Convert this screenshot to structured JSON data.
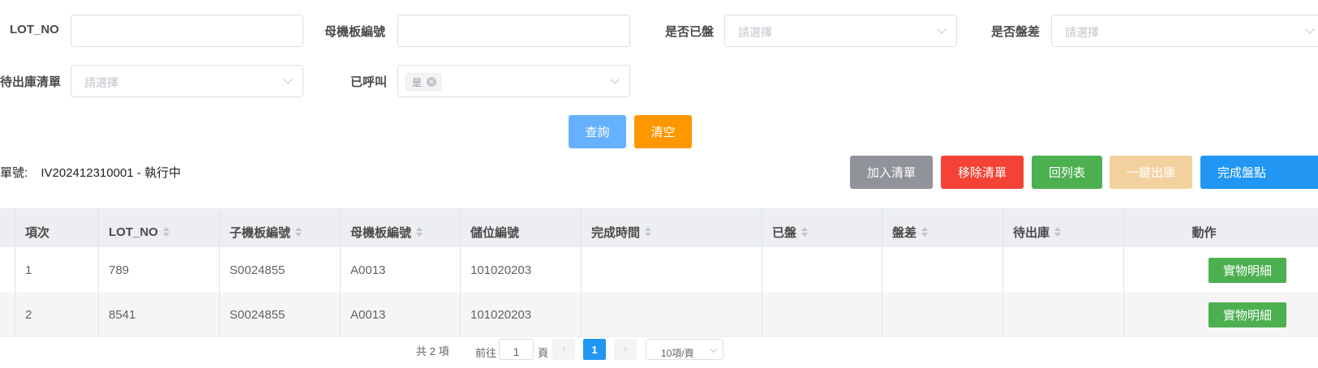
{
  "filters": {
    "lot_no_label": "LOT_NO",
    "mother_board_label": "母機板編號",
    "counted_label": "是否已盤",
    "diff_label": "是否盤差",
    "pending_out_label": "待出庫清單",
    "called_label": "已呼叫",
    "placeholder": "請選擇",
    "called_tag": "是"
  },
  "buttons": {
    "query": "查詢",
    "clear": "清空",
    "add_list": "加入清單",
    "remove_list": "移除清單",
    "back_list": "回列表",
    "one_click_out": "一鍵出庫",
    "finish_count": "完成盤點"
  },
  "order": {
    "label": "盤單號:",
    "value": "IV202412310001 - 執行中"
  },
  "table": {
    "columns": [
      "項次",
      "LOT_NO",
      "子機板編號",
      "母機板編號",
      "儲位編號",
      "完成時間",
      "已盤",
      "盤差",
      "待出庫",
      "動作"
    ],
    "rows": [
      {
        "idx": "1",
        "lot": "789",
        "child": "S0024855",
        "mother": "A0013",
        "loc": "101020203",
        "time": "",
        "counted": "",
        "diff": "",
        "pending": "",
        "action": "實物明細"
      },
      {
        "idx": "2",
        "lot": "8541",
        "child": "S0024855",
        "mother": "A0013",
        "loc": "101020203",
        "time": "",
        "counted": "",
        "diff": "",
        "pending": "",
        "action": "實物明細"
      }
    ]
  },
  "pagination": {
    "total": "共 2 項",
    "goto_prefix": "前往",
    "goto_value": "1",
    "goto_suffix": "頁",
    "current_page": "1",
    "page_size": "10項/頁"
  },
  "colors": {
    "query": "#66b1ff",
    "clear": "#ff9800",
    "add_list": "#909399",
    "remove_list": "#f44336",
    "back_list": "#4caf50",
    "one_click_out": "#f3d19e",
    "finish_count": "#2196f3",
    "row_action": "#4caf50"
  }
}
